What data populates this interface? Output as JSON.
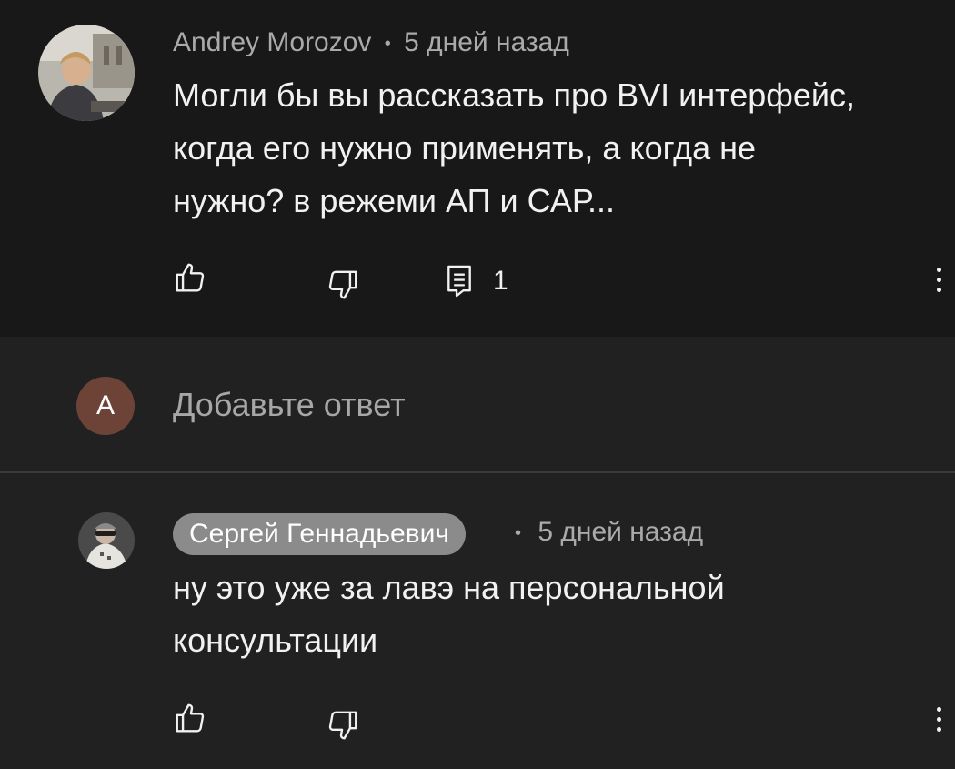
{
  "comment": {
    "author": "Andrey Morozov",
    "separator": "•",
    "time": "5 дней назад",
    "text_lines": [
      "Могли бы вы рассказать про BVI интерфейс,",
      "когда его нужно применять, а когда не",
      "нужно? в режеми АП и САР..."
    ],
    "reply_count": "1",
    "icons": {
      "like": "thumb-up-icon",
      "dislike": "thumb-down-icon",
      "replies": "comment-icon",
      "more": "more-vert-icon"
    }
  },
  "reply_box": {
    "avatar_letter": "A",
    "placeholder": "Добавьте ответ",
    "avatar_color": "#6d4338"
  },
  "reply": {
    "author": "Сергей Геннадьевич",
    "separator": "•",
    "time": "5 дней назад",
    "text_lines": [
      "ну это уже за лавэ на персональной",
      "консультации"
    ]
  },
  "colors": {
    "background": "#212121",
    "top_background": "#181818",
    "author_chip": "#8b8b8b"
  }
}
